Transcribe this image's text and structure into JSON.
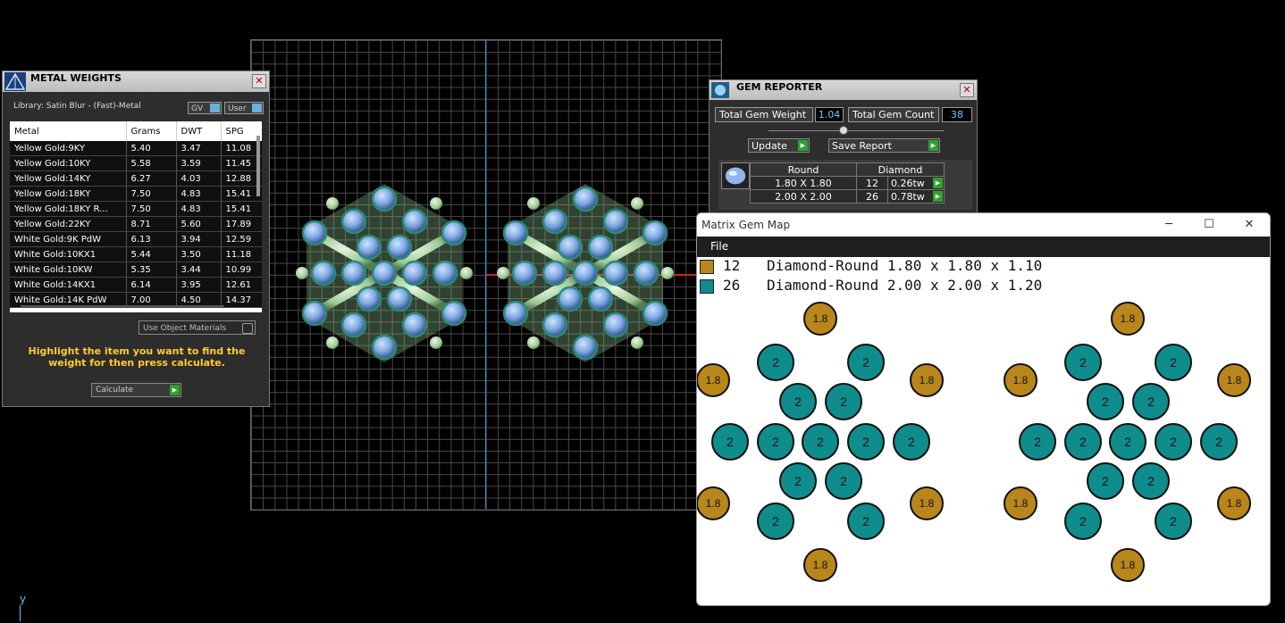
{
  "colors": {
    "gold": "#b8861b",
    "teal": "#0f8c8c",
    "gold_gem_label": "1.8",
    "teal_gem_label": "2"
  },
  "viewport": {
    "axis_label": "y"
  },
  "metal_weights": {
    "title": "METAL WEIGHTS",
    "library": "Library: Satin Blur - (Fast)-Metal",
    "gv_label": "GV",
    "user_label": "User",
    "columns": [
      "Metal",
      "Grams",
      "DWT",
      "SPG"
    ],
    "rows": [
      [
        "Yellow Gold:9KY",
        "5.40",
        "3.47",
        "11.08"
      ],
      [
        "Yellow Gold:10KY",
        "5.58",
        "3.59",
        "11.45"
      ],
      [
        "Yellow Gold:14KY",
        "6.27",
        "4.03",
        "12.88"
      ],
      [
        "Yellow Gold:18KY",
        "7.50",
        "4.83",
        "15.41"
      ],
      [
        "Yellow Gold:18KY R...",
        "7.50",
        "4.83",
        "15.41"
      ],
      [
        "Yellow Gold:22KY",
        "8.71",
        "5.60",
        "17.89"
      ],
      [
        "White Gold:9K PdW",
        "6.13",
        "3.94",
        "12.59"
      ],
      [
        "White Gold:10KX1",
        "5.44",
        "3.50",
        "11.18"
      ],
      [
        "White Gold:10KW",
        "5.35",
        "3.44",
        "10.99"
      ],
      [
        "White Gold:14KX1",
        "6.14",
        "3.95",
        "12.61"
      ],
      [
        "White Gold:14K PdW",
        "7.00",
        "4.50",
        "14.37"
      ]
    ],
    "use_object_materials": "Use Object Materials",
    "hint": "Highlight the item you want to find the weight for then press calculate.",
    "calculate": "Calculate"
  },
  "gem_reporter": {
    "title": "GEM REPORTER",
    "total_weight_label": "Total Gem Weight",
    "total_weight_value": "1.04",
    "total_count_label": "Total Gem Count",
    "total_count_value": "38",
    "update": "Update",
    "save_report": "Save Report",
    "header_shape": "Round",
    "header_type": "Diamond",
    "rows": [
      {
        "size": "1.80 X 1.80",
        "count": "12",
        "tw": "0.26tw"
      },
      {
        "size": "2.00 X 2.00",
        "count": "26",
        "tw": "0.78tw"
      }
    ]
  },
  "gem_map": {
    "title": "Matrix Gem Map",
    "menu_file": "File",
    "min": "─",
    "max": "☐",
    "close": "✕",
    "legend": [
      {
        "count": "12",
        "desc": "Diamond-Round 1.80 x 1.80 x 1.10",
        "color": "gold"
      },
      {
        "count": "26",
        "desc": "Diamond-Round 2.00 x 2.00 x 1.20",
        "color": "teal"
      }
    ]
  }
}
